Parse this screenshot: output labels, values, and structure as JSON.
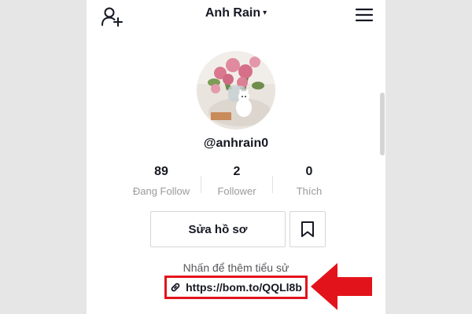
{
  "header": {
    "account_name": "Anh Rain",
    "caret": "▾"
  },
  "profile": {
    "username": "@anhrain0"
  },
  "stats": [
    {
      "value": "89",
      "label": "Đang Follow"
    },
    {
      "value": "2",
      "label": "Follower"
    },
    {
      "value": "0",
      "label": "Thích"
    }
  ],
  "actions": {
    "edit_profile": "Sửa hồ sơ"
  },
  "bio": {
    "placeholder": "Nhấn để thêm tiểu sử",
    "link": "https://bom.to/QQLl8b"
  },
  "icons": {
    "add_user": "add-user-icon",
    "menu": "hamburger-menu-icon",
    "bookmark": "bookmark-icon",
    "link": "link-icon",
    "arrow": "red-arrow-icon"
  },
  "colors": {
    "highlight": "#e3131c",
    "text": "#161823",
    "muted": "#9a9a9e"
  }
}
